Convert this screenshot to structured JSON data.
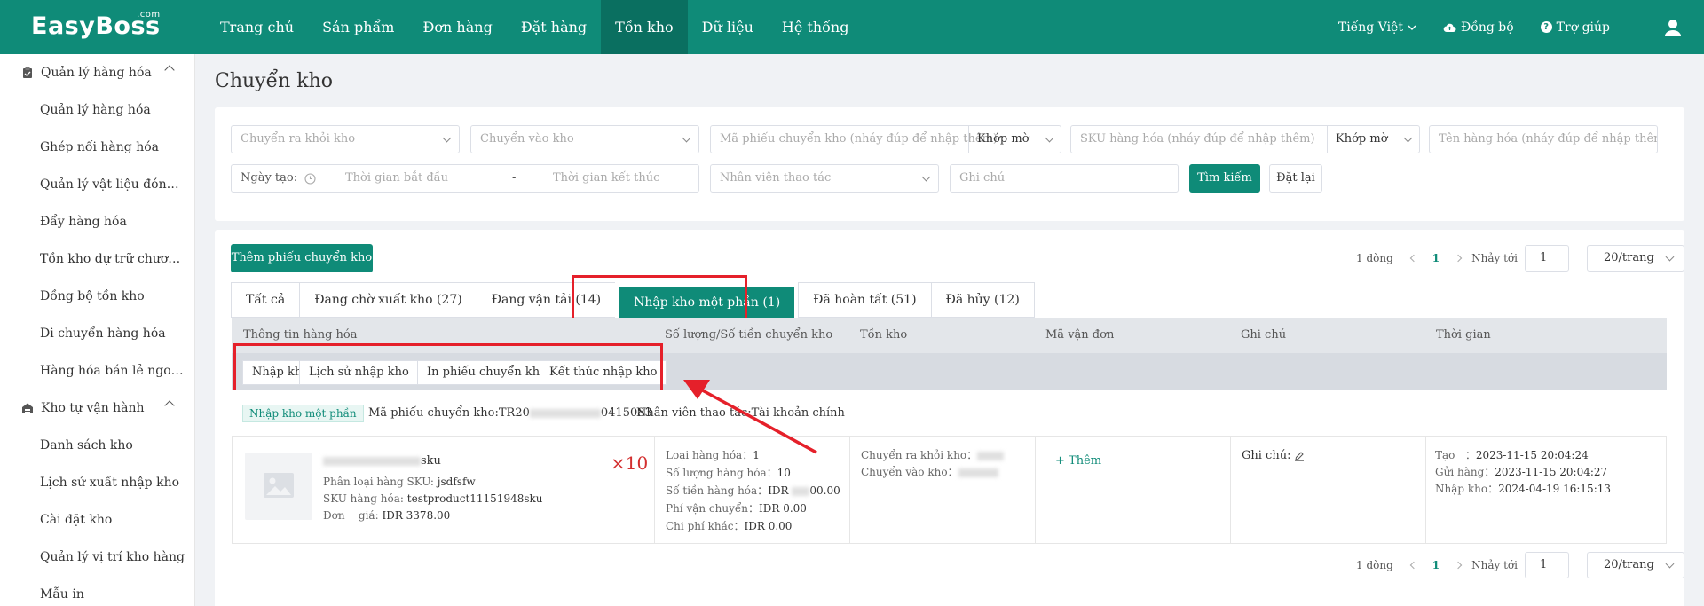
{
  "brand": {
    "logo_text": "EasyBoss",
    "logo_sup": ".com"
  },
  "nav": {
    "items": [
      "Trang chủ",
      "Sản phẩm",
      "Đơn hàng",
      "Đặt hàng",
      "Tồn kho",
      "Dữ liệu",
      "Hệ thống"
    ],
    "active_index": 4,
    "language": "Tiếng Việt",
    "sync": "Đồng bộ",
    "help": "Trợ giúp"
  },
  "sidebar": {
    "group1": "Quản lý hàng hóa",
    "group1_items": [
      "Quản lý hàng hóa",
      "Ghép nối hàng hóa",
      "Quản lý vật liệu đóng gói",
      "Đẩy hàng hóa",
      "Tồn kho dự trữ chương trình",
      "Đồng bộ tồn kho",
      "Di chuyển hàng hóa",
      "Hàng hóa bán lẻ ngoại tuyến"
    ],
    "group2": "Kho tự vận hành",
    "group2_items": [
      "Danh sách kho",
      "Lịch sử xuất nhập kho",
      "Cài đặt kho",
      "Quản lý vị trí kho hàng",
      "Mẫu in"
    ]
  },
  "page": {
    "title": "Chuyển kho"
  },
  "filters": {
    "from_warehouse": "Chuyển ra khỏi kho",
    "to_warehouse": "Chuyển vào kho",
    "transfer_code": "Mã phiếu chuyển kho (nháy đúp để nhập thêm)",
    "match1": "Khớp mờ",
    "sku": "SKU hàng hóa (nháy đúp để nhập thêm)",
    "match2": "Khớp mờ",
    "product_name": "Tên hàng hóa (nháy đúp để nhập thêm)",
    "created_label": "Ngày tạo:",
    "start_time": "Thời gian bắt đầu",
    "dash": "-",
    "end_time": "Thời gian kết thúc",
    "operator": "Nhân viên thao tác",
    "note": "Ghi chú",
    "search_btn": "Tìm kiếm",
    "reset_btn": "Đặt lại"
  },
  "list": {
    "add_btn": "Thêm phiếu chuyển kho",
    "pager": {
      "rows": "1 dòng",
      "page": "1",
      "goto": "Nhảy tới",
      "goto_value": "1",
      "size": "20/trang"
    },
    "tabs": [
      "Tất cả",
      "Đang chờ xuất kho (27)",
      "Đang vận tải (14)",
      "Nhập kho một phần (1)",
      "Đã hoàn tất (51)",
      "Đã hủy (12)"
    ],
    "active_tab": 3,
    "columns": [
      "Thông tin hàng hóa",
      "Số lượng/Số tiền chuyển kho",
      "Tồn kho",
      "Mã vận đơn",
      "Ghi chú",
      "Thời gian"
    ],
    "actions": [
      "Nhập kho",
      "Lịch sử nhập kho",
      "In phiếu chuyển kho",
      "Kết thúc nhập kho"
    ]
  },
  "order": {
    "status_badge": "Nhập kho một phần",
    "code_label": "Mã phiếu chuyển kho:TR20",
    "code_suffix": "0415083",
    "operator_label": "Nhân viên thao tác:",
    "operator_value": "Tài khoản chính",
    "item": {
      "name_suffix": "sku",
      "variant_label": "Phân loại hàng SKU:",
      "variant_value": "jsdfsfw",
      "sku_label": "SKU hàng hóa:",
      "sku_value": "testproduct11151948sku",
      "price_label": "Đơn    giá:",
      "price_value": "IDR 3378.00",
      "qty": "×10"
    },
    "amounts": {
      "types_label": "Loại hàng hóa：",
      "types_value": "1",
      "count_label": "Số lượng hàng hóa：",
      "count_value": "10",
      "money_label": "Số tiền hàng hóa：",
      "money_prefix": "IDR ",
      "money_suffix": "00.00",
      "ship_label": "Phí vận chuyển：",
      "ship_value": "IDR 0.00",
      "other_label": "Chi phí khác：",
      "other_value": "IDR 0.00"
    },
    "stock": {
      "from_label": "Chuyển ra khỏi kho：",
      "to_label": "Chuyển vào kho："
    },
    "waybill_add": "+ Thêm",
    "note_label": "Ghi chú:",
    "times": {
      "created_label": "Tạo   ：",
      "created": "2023-11-15 20:04:24",
      "sent_label": "Gửi hàng：",
      "sent": "2023-11-15 20:04:27",
      "in_label": "Nhập kho：",
      "in": "2024-04-19 16:15:13"
    }
  },
  "colors": {
    "brand": "#0f8b78",
    "highlight": "#e5202a"
  }
}
